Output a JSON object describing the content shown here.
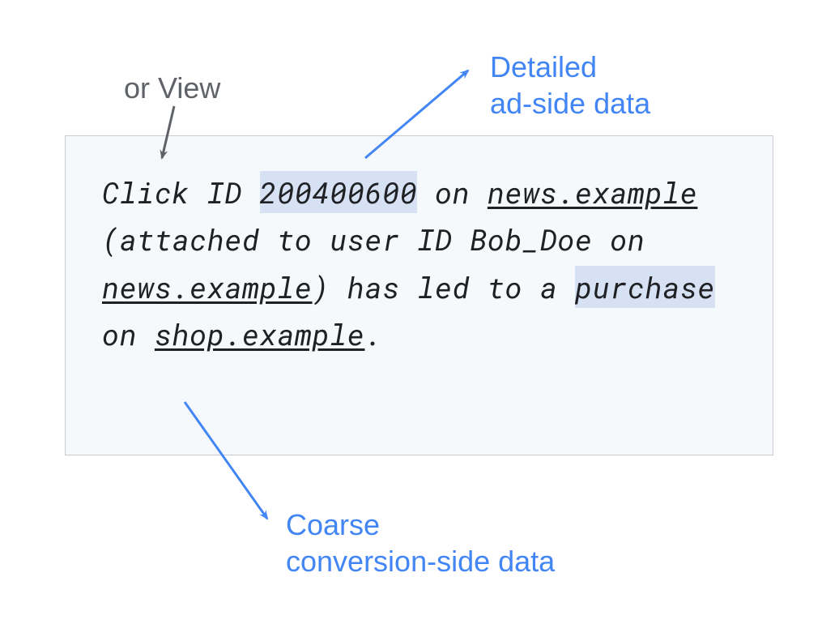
{
  "annotations": {
    "top_gray": "or View",
    "top_blue_line1": "Detailed",
    "top_blue_line2": "ad-side data",
    "bottom_blue_line1": "Coarse",
    "bottom_blue_line2": "conversion-side data"
  },
  "box": {
    "text_part1": "Click ID ",
    "click_id": "200400600",
    "text_part2": " on ",
    "site1": "news.example",
    "text_part3": " (attached to user ID Bob_Doe on ",
    "site1_again": "news.example",
    "text_part4": ") has led to a ",
    "purchase": "purchase",
    "text_part5": " on ",
    "site2": "shop.example",
    "text_part6": "."
  }
}
